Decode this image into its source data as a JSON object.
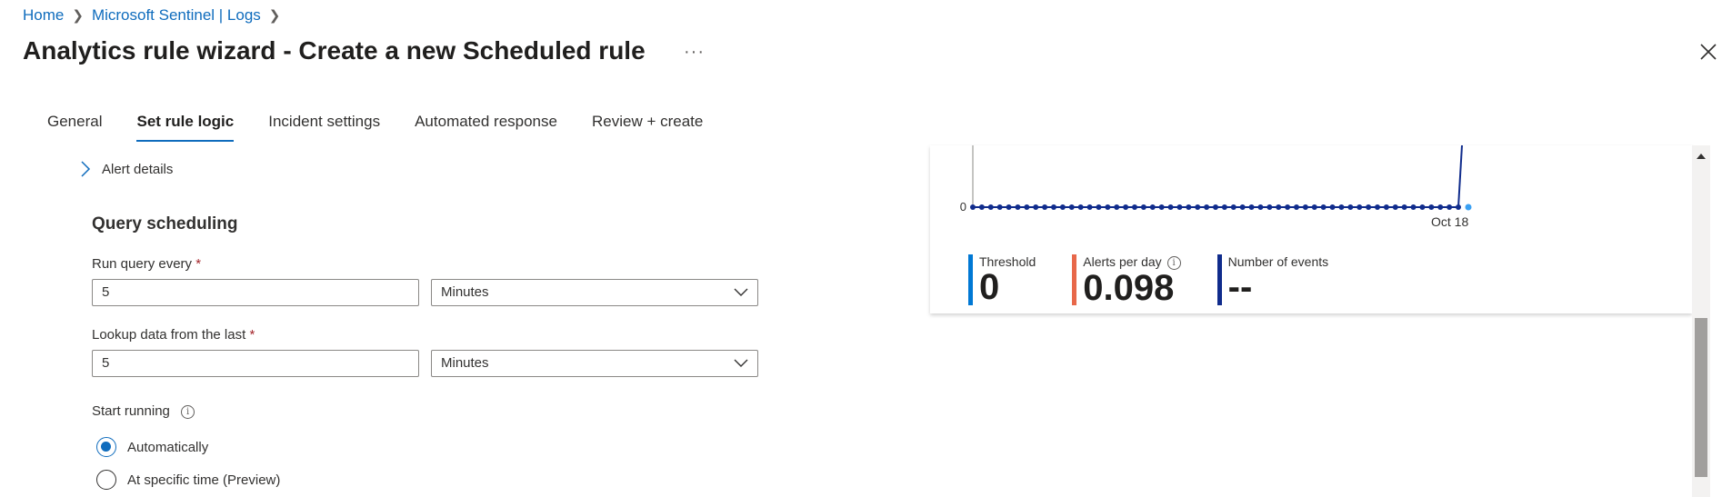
{
  "breadcrumb": {
    "home": "Home",
    "parent": "Microsoft Sentinel | Logs"
  },
  "header": {
    "title": "Analytics rule wizard - Create a new Scheduled rule",
    "more": "···"
  },
  "tabs": [
    {
      "label": "General",
      "active": false
    },
    {
      "label": "Set rule logic",
      "active": true
    },
    {
      "label": "Incident settings",
      "active": false
    },
    {
      "label": "Automated response",
      "active": false
    },
    {
      "label": "Review + create",
      "active": false
    }
  ],
  "alert_details": {
    "label": "Alert details"
  },
  "query_scheduling": {
    "title": "Query scheduling",
    "run_every": {
      "label": "Run query every",
      "required": "*",
      "value": "5",
      "unit": "Minutes"
    },
    "lookup": {
      "label": "Lookup data from the last",
      "required": "*",
      "value": "5",
      "unit": "Minutes"
    },
    "start_running": {
      "label": "Start running",
      "info": "i",
      "options": [
        {
          "label": "Automatically",
          "selected": true
        },
        {
          "label": "At specific time (Preview)",
          "selected": false
        }
      ]
    }
  },
  "chart": {
    "y_tick": "0",
    "x_tick": "Oct 18",
    "metrics": [
      {
        "label": "Threshold",
        "value": "0",
        "color": "#0078d4"
      },
      {
        "label": "Alerts per day",
        "value": "0.098",
        "color": "#e8684a",
        "info": "i"
      },
      {
        "label": "Number of events",
        "value": "--",
        "color": "#102c8c"
      }
    ]
  },
  "colors": {
    "accent": "#0f6cbd",
    "series": "#102c8c"
  }
}
